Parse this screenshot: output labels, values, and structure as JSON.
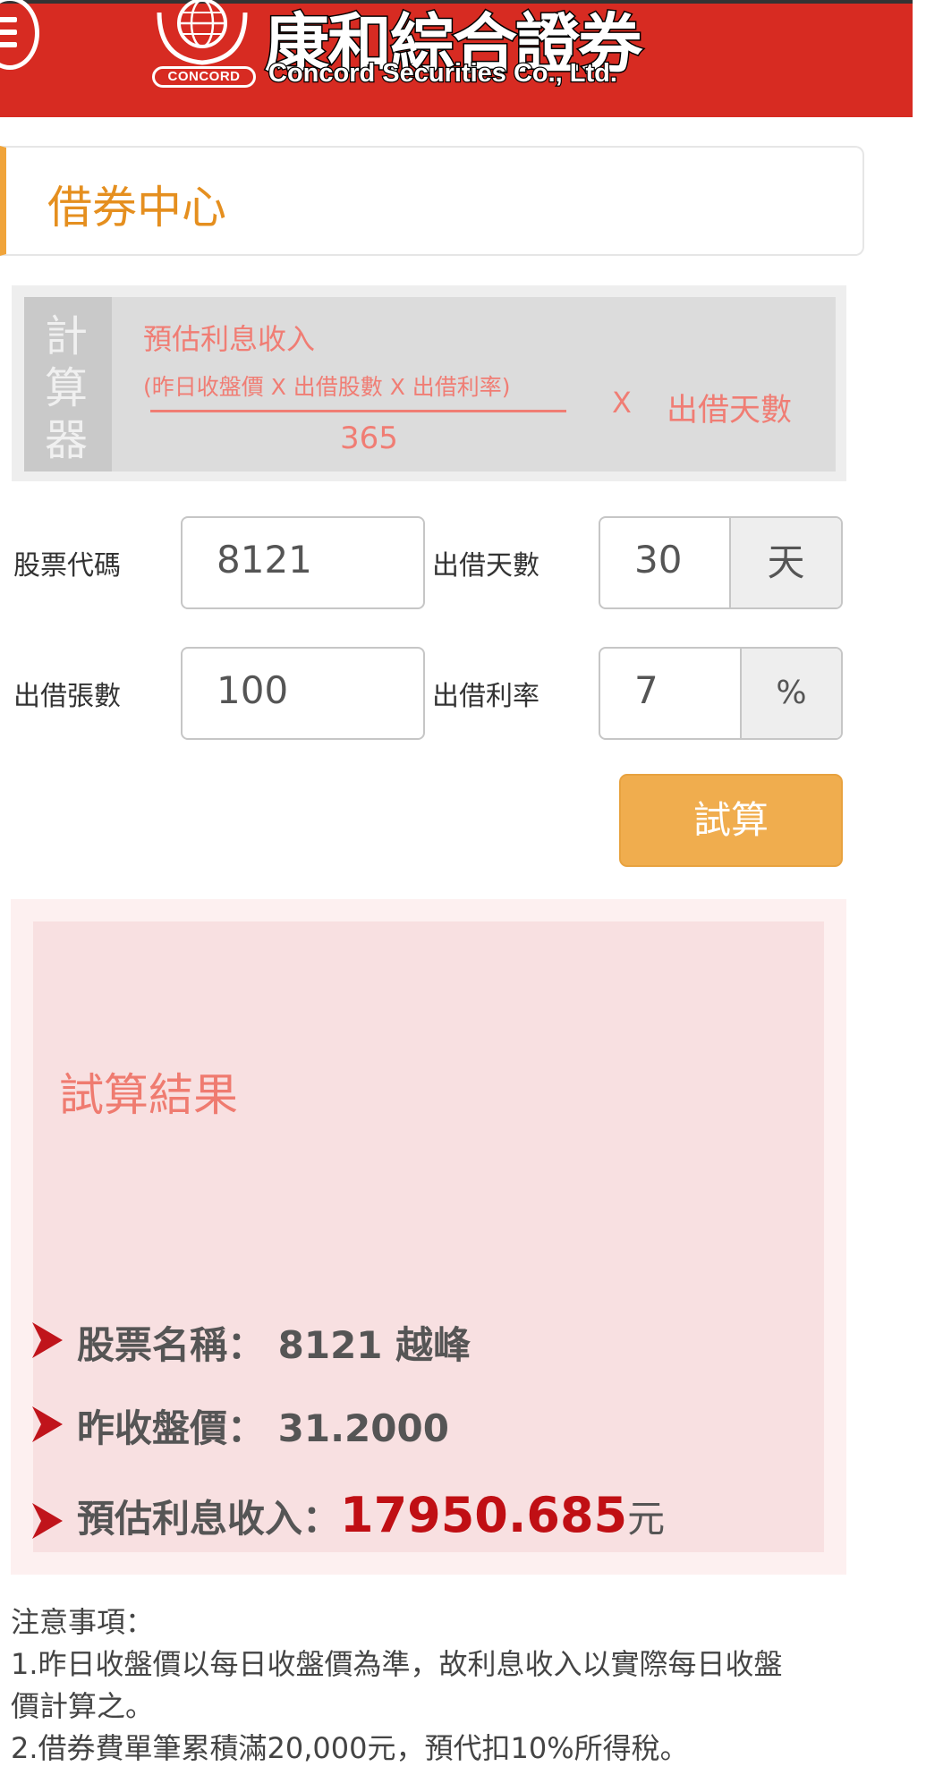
{
  "header": {
    "logo_title": "康和綜合證券",
    "logo_subtitle": "Concord Securities Co., Ltd.",
    "logo_badge": "CONCORD",
    "brand_color": "#d72b22"
  },
  "page": {
    "title": "借券中心"
  },
  "formula": {
    "label_chars": [
      "計",
      "算",
      "器"
    ],
    "numerator_title": "預估利息收入",
    "numerator_detail": "(昨日收盤價 X 出借股數 X 出借利率)",
    "denominator": "365",
    "multiply": "X",
    "days": "出借天數"
  },
  "form": {
    "stock_code_label": "股票代碼",
    "stock_code_value": "8121",
    "lend_days_label": "出借天數",
    "lend_days_value": "30",
    "lend_days_unit": "天",
    "lend_qty_label": "出借張數",
    "lend_qty_value": "100",
    "lend_rate_label": "出借利率",
    "lend_rate_value": "7",
    "lend_rate_unit": "%",
    "calc_button": "試算"
  },
  "result": {
    "title": "試算結果",
    "stock_name_label": "股票名稱：",
    "stock_name_value": "8121 越峰",
    "close_price_label": "昨收盤價：",
    "close_price_value": "31.2000",
    "income_label": "預估利息收入：",
    "income_value": "17950.685",
    "income_unit": "元"
  },
  "notes": {
    "title": "注意事項：",
    "line1a": "1.昨日收盤價以每日收盤價為準，故利息收入以實際每日收盤",
    "line1b": "價計算之。",
    "line2": "2.借券費單筆累積滿20,000元，預代扣10%所得稅。"
  }
}
